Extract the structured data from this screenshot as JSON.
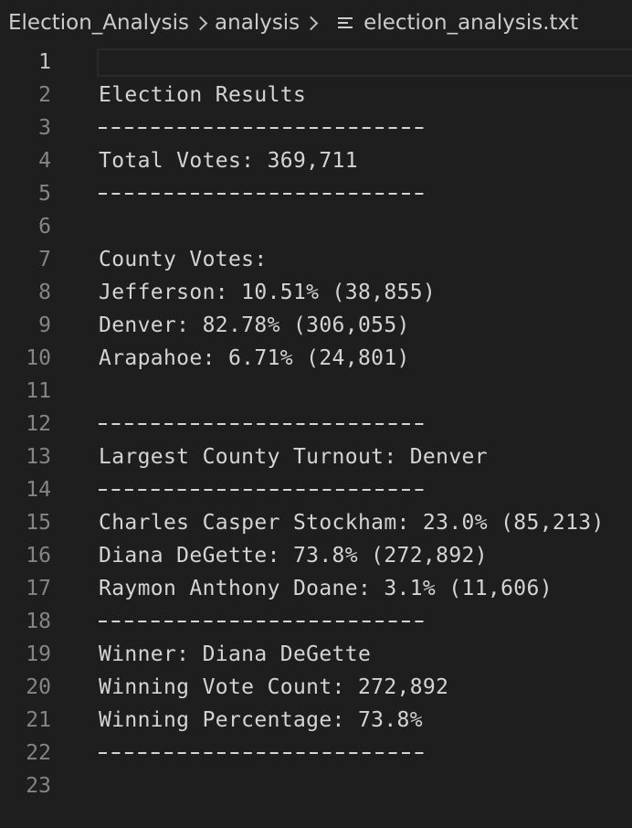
{
  "breadcrumb": {
    "items": [
      "Election_Analysis",
      "analysis"
    ],
    "file_name": "election_analysis.txt"
  },
  "editor": {
    "active_line": 1,
    "lines": [
      {
        "number": "1",
        "text": ""
      },
      {
        "number": "2",
        "text": "Election Results"
      },
      {
        "number": "3",
        "text": "-------------------------"
      },
      {
        "number": "4",
        "text": "Total Votes: 369,711"
      },
      {
        "number": "5",
        "text": "-------------------------"
      },
      {
        "number": "6",
        "text": ""
      },
      {
        "number": "7",
        "text": "County Votes:"
      },
      {
        "number": "8",
        "text": "Jefferson: 10.51% (38,855)"
      },
      {
        "number": "9",
        "text": "Denver: 82.78% (306,055)"
      },
      {
        "number": "10",
        "text": "Arapahoe: 6.71% (24,801)"
      },
      {
        "number": "11",
        "text": ""
      },
      {
        "number": "12",
        "text": "-------------------------"
      },
      {
        "number": "13",
        "text": "Largest County Turnout: Denver"
      },
      {
        "number": "14",
        "text": "-------------------------"
      },
      {
        "number": "15",
        "text": "Charles Casper Stockham: 23.0% (85,213)"
      },
      {
        "number": "16",
        "text": "Diana DeGette: 73.8% (272,892)"
      },
      {
        "number": "17",
        "text": "Raymon Anthony Doane: 3.1% (11,606)"
      },
      {
        "number": "18",
        "text": "-------------------------"
      },
      {
        "number": "19",
        "text": "Winner: Diana DeGette"
      },
      {
        "number": "20",
        "text": "Winning Vote Count: 272,892"
      },
      {
        "number": "21",
        "text": "Winning Percentage: 73.8%"
      },
      {
        "number": "22",
        "text": "-------------------------"
      },
      {
        "number": "23",
        "text": ""
      }
    ]
  },
  "colors": {
    "background": "#1e1e1e",
    "text": "#d4d4d4",
    "line_number": "#858585"
  }
}
